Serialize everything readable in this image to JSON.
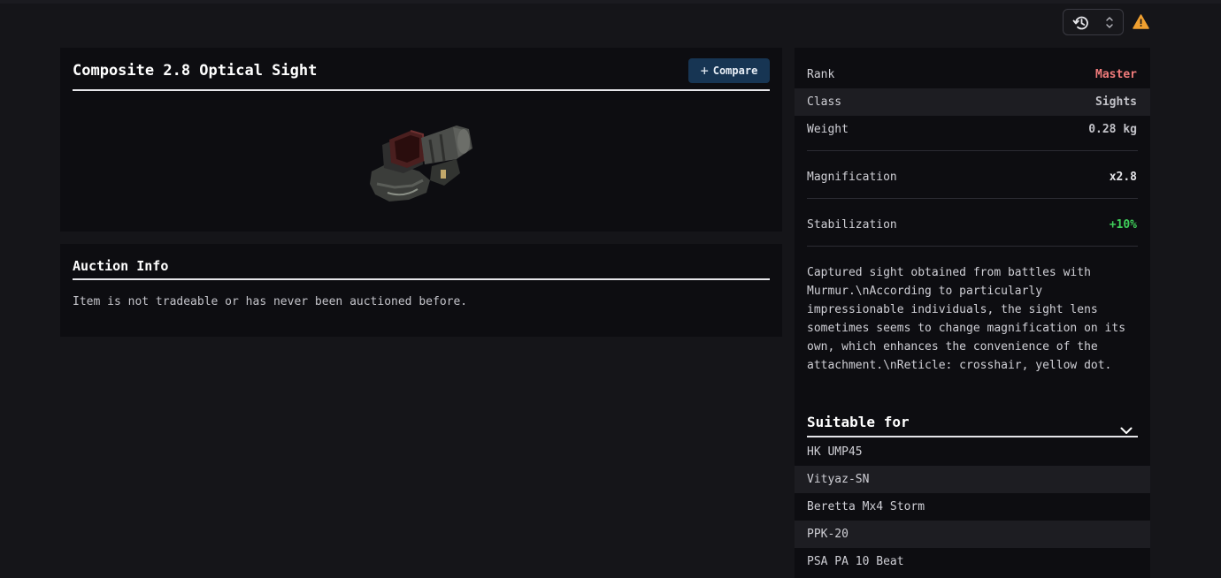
{
  "item": {
    "title": "Composite 2.8 Optical Sight",
    "compare_label": "Compare"
  },
  "auction": {
    "title": "Auction Info",
    "text": "Item is not tradeable or has never been auctioned before."
  },
  "stats": [
    {
      "label": "Rank",
      "value": "Master"
    },
    {
      "label": "Class",
      "value": "Sights"
    },
    {
      "label": "Weight",
      "value": "0.28 kg"
    },
    {
      "label": "Magnification",
      "value": "x2.8"
    },
    {
      "label": "Stabilization",
      "value": "+10%"
    }
  ],
  "description": "Captured sight obtained from battles with Murmur.\\nAccording to particularly impressionable individuals, the sight lens sometimes seems to change magnification on its own, which enhances the convenience of the attachment.\\nReticle: crosshair, yellow dot.",
  "suitable": {
    "title": "Suitable for",
    "weapons": [
      "HK UMP45",
      "Vityaz-SN",
      "Beretta Mx4 Storm",
      "PPK-20",
      "PSA PA 10 Beat"
    ]
  },
  "colors": {
    "rank_master": "#f07b7b",
    "stat_positive": "#3fcf5a",
    "compare_bg": "#173553",
    "warning": "#f0a030"
  },
  "icons": {
    "history": "history-icon",
    "sort": "chevron-up-down-icon",
    "warning": "warning-icon",
    "compare": "plus-icon",
    "collapse": "chevron-down-icon"
  }
}
